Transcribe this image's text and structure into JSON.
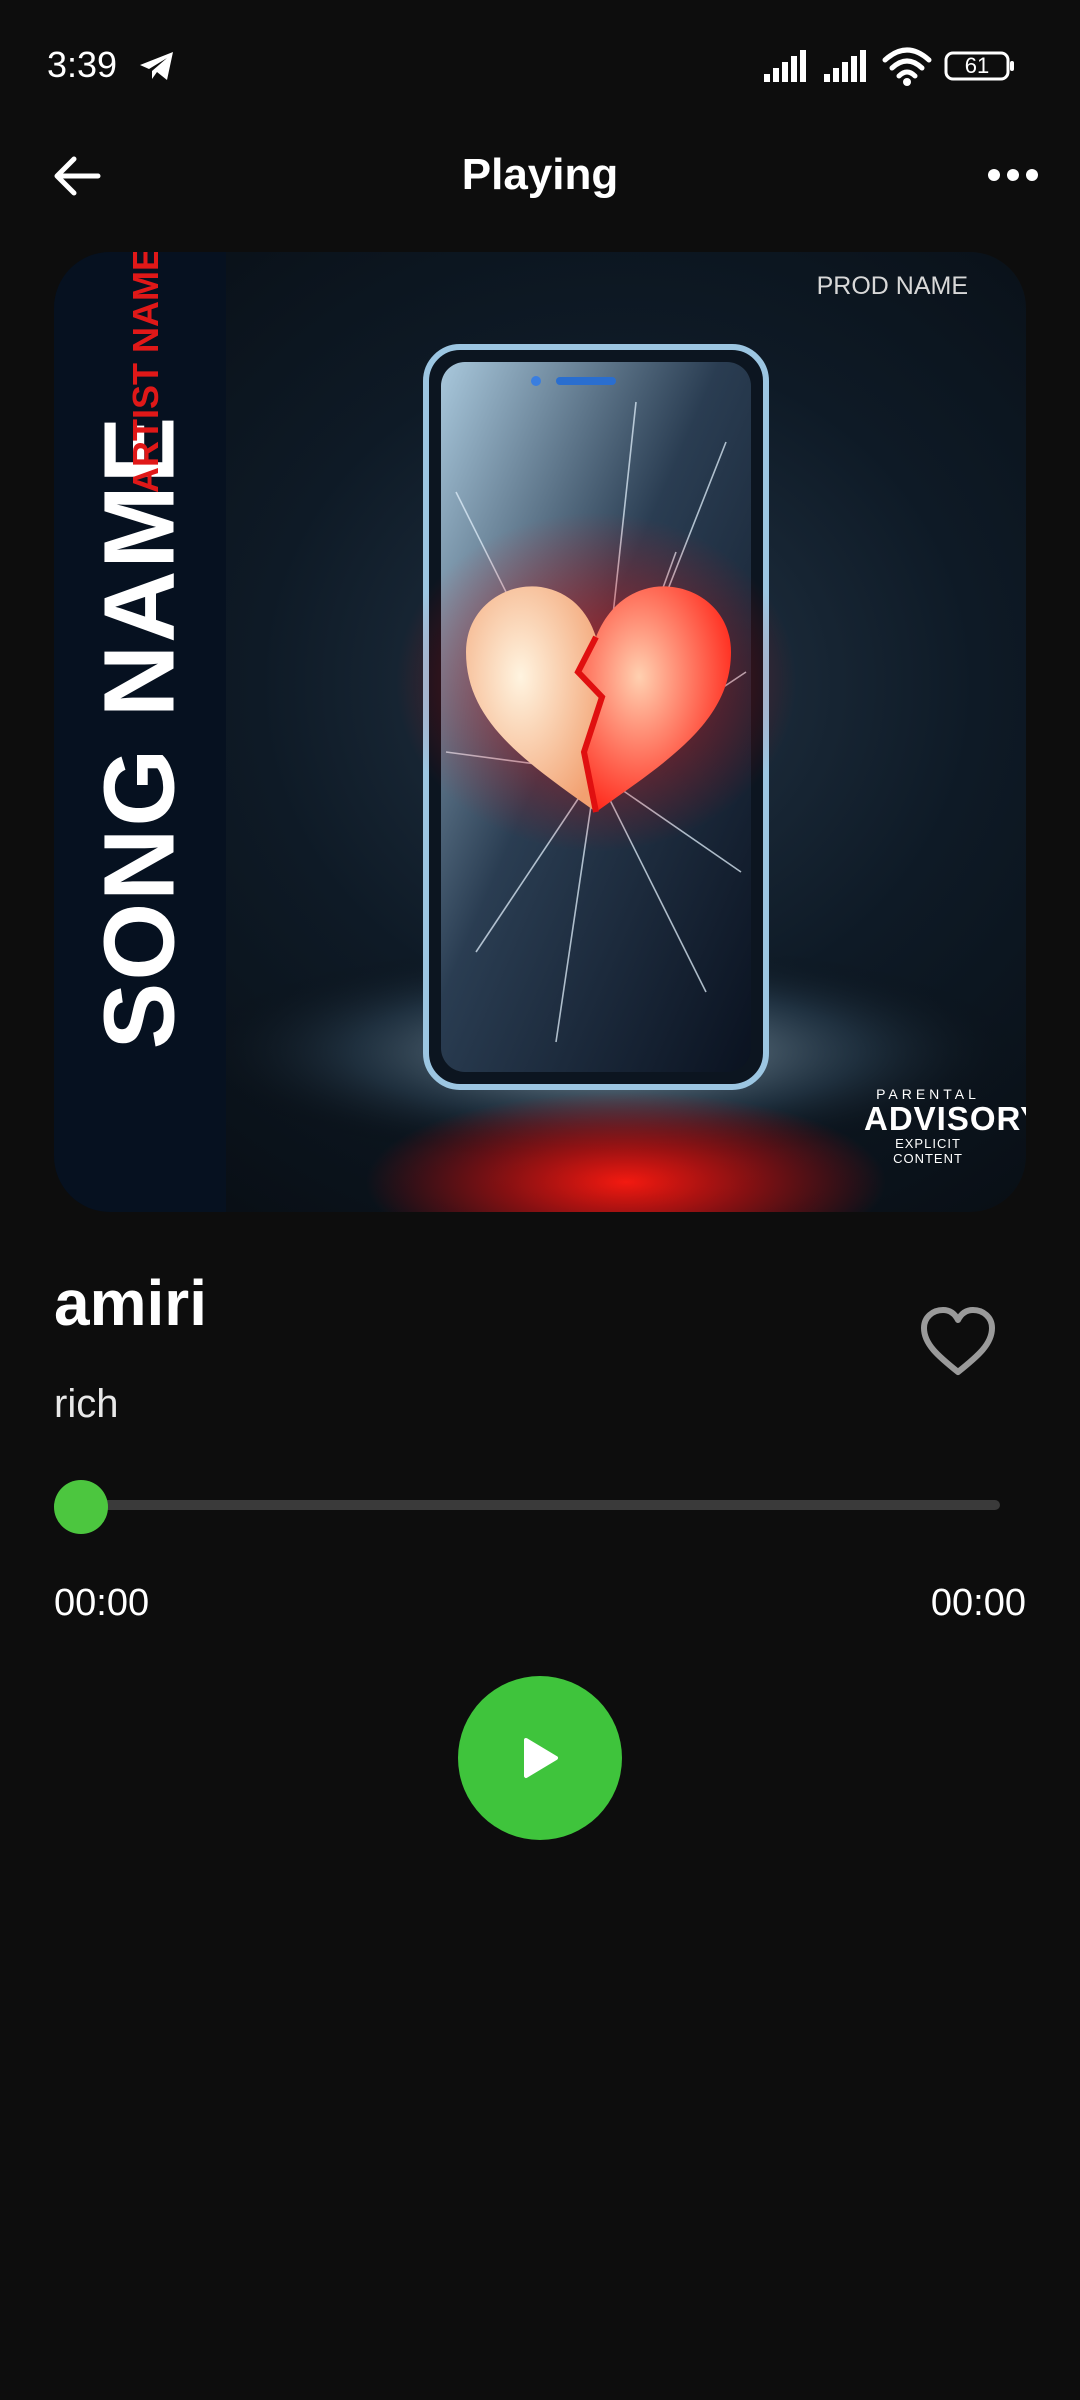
{
  "status_bar": {
    "time": "3:39",
    "battery_level": "61",
    "icons": [
      "telegram-icon",
      "signal-icon",
      "signal-icon",
      "wifi-icon",
      "battery-icon"
    ]
  },
  "header": {
    "title": "Playing",
    "back_icon": "arrow-left-icon",
    "more_icon": "more-horizontal-icon"
  },
  "cover": {
    "song_name": "SONG NAME",
    "artist_name": "ARTIST NAME",
    "prod_name": "PROD NAME",
    "advisory_line1": "PARENTAL",
    "advisory_line2": "ADVISORY",
    "advisory_line3": "EXPLICIT CONTENT"
  },
  "track": {
    "title": "amiri",
    "artist": "rich",
    "liked": false
  },
  "player": {
    "elapsed": "00:00",
    "total": "00:00",
    "progress": 0,
    "play_icon": "play-icon",
    "accent_color": "#3fc43c"
  }
}
